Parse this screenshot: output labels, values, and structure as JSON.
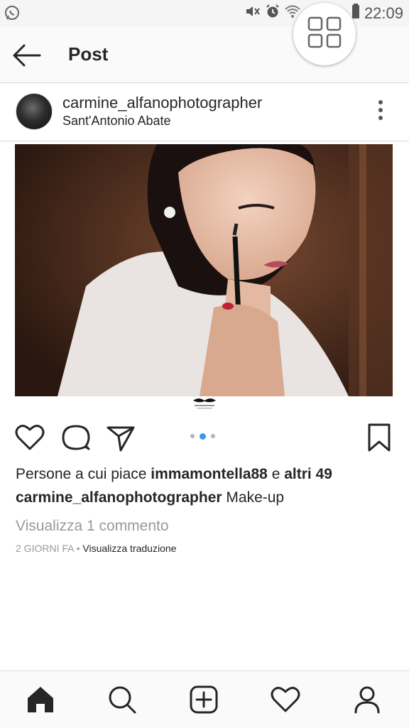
{
  "status_bar": {
    "time": "22:09",
    "icons": [
      "whatsapp-icon",
      "mute-icon",
      "alarm-icon",
      "wifi-icon",
      "battery-icon"
    ]
  },
  "header": {
    "title": "Post",
    "back_icon": "back-arrow-icon",
    "floating_icon": "grid-icon"
  },
  "post": {
    "username": "carmine_alfanophotographer",
    "location": "Sant'Antonio Abate",
    "more_icon": "more-vertical-icon",
    "carousel": {
      "count": 3,
      "active_index": 1
    },
    "likes": {
      "prefix": "Persone a cui piace",
      "liker": "immamontella88",
      "connector": "e",
      "others": "altri 49"
    },
    "caption": {
      "username": "carmine_alfanophotographer",
      "text": "Make-up"
    },
    "view_comments": "Visualizza 1 commento",
    "time_ago": "2 GIORNI FA",
    "separator": "•",
    "translate": "Visualizza traduzione"
  },
  "actions": [
    "heart-icon",
    "comment-icon",
    "share-icon",
    "bookmark-icon"
  ],
  "bottom_nav": [
    "home-icon",
    "search-icon",
    "add-icon",
    "activity-icon",
    "profile-icon"
  ]
}
